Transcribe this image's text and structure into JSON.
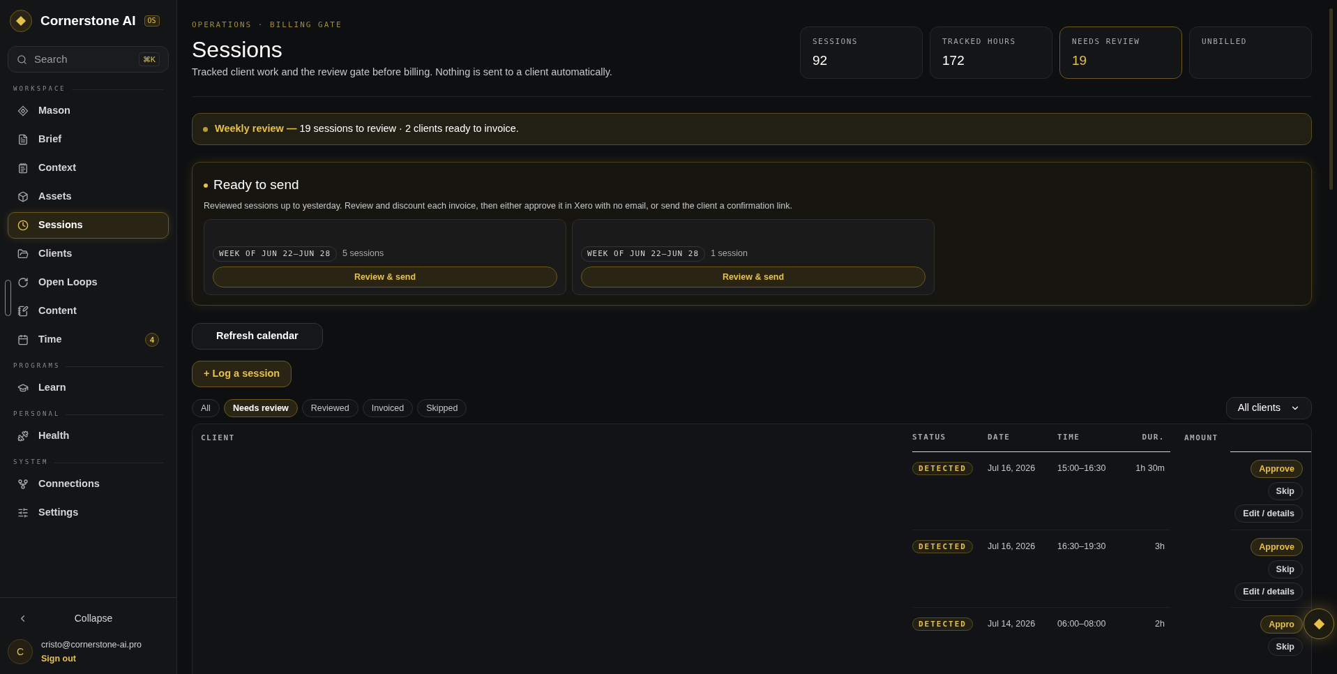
{
  "brand": {
    "name": "Cornerstone AI",
    "tag": "OS"
  },
  "search": {
    "placeholder": "Search",
    "shortcut": "⌘K"
  },
  "sidebar": {
    "sections": [
      {
        "label": "WORKSPACE",
        "items": [
          {
            "label": "Mason",
            "selected": false
          },
          {
            "label": "Brief",
            "selected": false
          },
          {
            "label": "Context",
            "selected": false
          },
          {
            "label": "Assets",
            "selected": false
          },
          {
            "label": "Sessions",
            "selected": true
          },
          {
            "label": "Clients",
            "selected": false
          },
          {
            "label": "Open Loops",
            "selected": false
          },
          {
            "label": "Content",
            "selected": false
          },
          {
            "label": "Time",
            "selected": false,
            "badge": "4"
          }
        ]
      },
      {
        "label": "PROGRAMS",
        "items": [
          {
            "label": "Learn",
            "selected": false
          }
        ]
      },
      {
        "label": "PERSONAL",
        "items": [
          {
            "label": "Health",
            "selected": false
          }
        ]
      },
      {
        "label": "SYSTEM",
        "items": [
          {
            "label": "Connections",
            "selected": false
          },
          {
            "label": "Settings",
            "selected": false
          }
        ]
      }
    ],
    "collapse": "Collapse",
    "user": {
      "initial": "C",
      "email": "cristo@cornerstone-ai.pro",
      "sign_out": "Sign out"
    }
  },
  "header": {
    "eyebrow": "OPERATIONS · BILLING GATE",
    "title": "Sessions",
    "subtitle": "Tracked client work and the review gate before billing. Nothing is sent to a client automatically."
  },
  "stats": [
    {
      "label": "SESSIONS",
      "value": "92",
      "attention": false
    },
    {
      "label": "TRACKED HOURS",
      "value": "172",
      "attention": false
    },
    {
      "label": "NEEDS REVIEW",
      "value": "19",
      "attention": true
    },
    {
      "label": "UNBILLED",
      "attention": false
    }
  ],
  "banner": "**Weekly review —** 19 sessions to review · 2 clients ready to invoice.",
  "ready": {
    "title": "Ready to send",
    "description": "Reviewed sessions up to yesterday. Review and discount each invoice, then either approve it in Xero with no email, or send the client a confirmation link.",
    "cards": [
      {
        "week": "WEEK OF JUN 22–JUN 28",
        "count": "5 sessions",
        "action": "Review & send"
      },
      {
        "week": "WEEK OF JUN 22–JUN 28",
        "count": "1 session",
        "action": "Review & send"
      }
    ]
  },
  "refresh_button": "Refresh calendar",
  "log_button": "+ Log a session",
  "filters": [
    {
      "label": "All",
      "selected": false
    },
    {
      "label": "Needs review",
      "selected": true
    },
    {
      "label": "Reviewed",
      "selected": false
    },
    {
      "label": "Invoiced",
      "selected": false
    },
    {
      "label": "Skipped",
      "selected": false
    }
  ],
  "client_select": "All clients",
  "table": {
    "columns": [
      "CLIENT",
      "STATUS",
      "DATE",
      "TIME",
      "DUR.",
      "AMOUNT"
    ],
    "rows": [
      {
        "status": "DETECTED",
        "date": "Jul 16, 2026",
        "time": "15:00–16:30",
        "duration": "1h 30m",
        "actions": [
          {
            "label": "Approve",
            "kind": "primary"
          },
          {
            "label": "Skip",
            "kind": "secondary"
          },
          {
            "label": "Edit / details",
            "kind": "secondary"
          }
        ]
      },
      {
        "status": "DETECTED",
        "date": "Jul 16, 2026",
        "time": "16:30–19:30",
        "duration": "3h",
        "actions": [
          {
            "label": "Approve",
            "kind": "primary"
          },
          {
            "label": "Skip",
            "kind": "secondary"
          },
          {
            "label": "Edit / details",
            "kind": "secondary"
          }
        ]
      },
      {
        "status": "DETECTED",
        "date": "Jul 14, 2026",
        "time": "06:00–08:00",
        "duration": "2h",
        "actions": [
          {
            "label": "Appro",
            "kind": "primary"
          },
          {
            "label": "Skip",
            "kind": "secondary"
          }
        ]
      }
    ]
  }
}
